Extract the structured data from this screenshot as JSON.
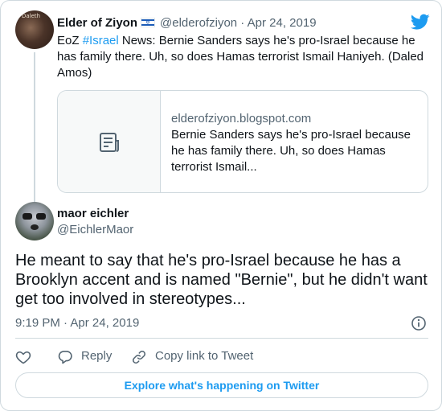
{
  "parent_tweet": {
    "avatar_text": "Daleth",
    "display_name": "Elder of Ziyon",
    "flag_icon": "israel-flag-icon",
    "handle": "@elderofziyon",
    "separator": "·",
    "date": "Apr 24, 2019",
    "text_prefix": "EoZ ",
    "hashtag": "#Israel",
    "text_rest": " News: Bernie Sanders says he's pro-Israel because he has family there. Uh, so does Hamas terrorist Ismail Haniyeh. (Daled Amos)",
    "link_card": {
      "thumb_icon": "document-icon",
      "domain": "elderofziyon.blogspot.com",
      "title": "Bernie Sanders says he's pro-Israel because he has family there. Uh, so does Hamas terrorist Ismail..."
    }
  },
  "brand_icon": "twitter-bird-icon",
  "tweet": {
    "display_name": "maor eichler",
    "handle": "@EichlerMaor",
    "text": "He meant to say that he's pro-Israel because he has a Brooklyn accent and is named \"Bernie\", but he didn't want get too involved in stereotypes...",
    "time": "9:19 PM",
    "separator": "·",
    "date": "Apr 24, 2019",
    "info_icon": "info-icon"
  },
  "actions": {
    "like_icon": "heart-icon",
    "reply_icon": "reply-icon",
    "reply_label": "Reply",
    "copy_icon": "link-icon",
    "copy_label": "Copy link to Tweet"
  },
  "explore_label": "Explore what's happening on Twitter",
  "colors": {
    "accent": "#1d9bf0",
    "text": "#0f1419",
    "secondary": "#536471",
    "border": "#cfd9de"
  }
}
